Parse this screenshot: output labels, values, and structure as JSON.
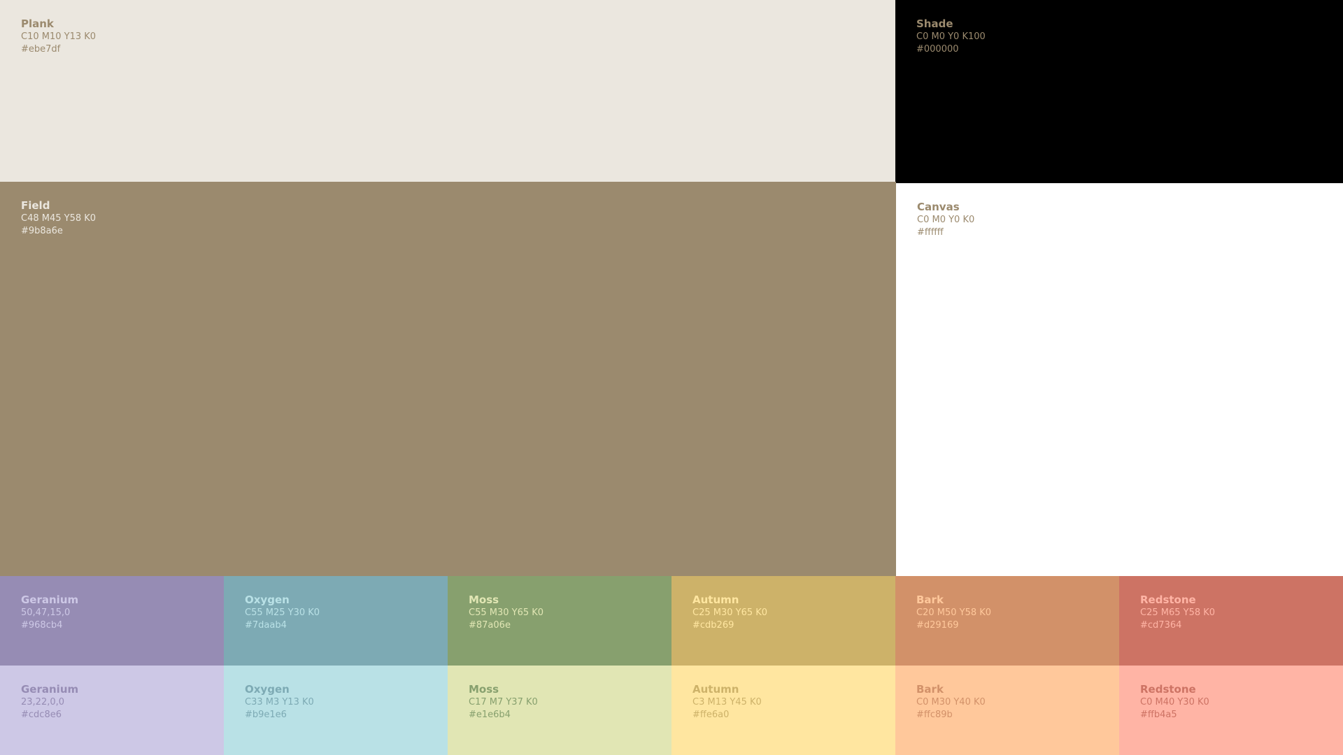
{
  "swatches": {
    "plank": {
      "name": "Plank",
      "cmyk": "C10 M10 Y13 K0",
      "hex": "#ebe7df",
      "bg": "#ebe7df",
      "fg": "#9b8a6e"
    },
    "shade": {
      "name": "Shade",
      "cmyk": "C0 M0 Y0 K100",
      "hex": "#000000",
      "bg": "#000000",
      "fg": "#9b8a6e"
    },
    "field": {
      "name": "Field",
      "cmyk": "C48 M45 Y58 K0",
      "hex": "#9b8a6e",
      "bg": "#9b8a6e",
      "fg": "#ebe7df"
    },
    "canvas": {
      "name": "Canvas",
      "cmyk": "C0 M0 Y0 K0",
      "hex": "#ffffff",
      "bg": "#ffffff",
      "fg": "#9b8a6e"
    },
    "geranium": {
      "name": "Geranium",
      "cmyk": "50,47,15,0",
      "hex": "#968cb4",
      "bg": "#968cb4",
      "fg": "#cdc8e6"
    },
    "oxygen": {
      "name": "Oxygen",
      "cmyk": "C55 M25 Y30 K0",
      "hex": "#7daab4",
      "bg": "#7daab4",
      "fg": "#b9e1e6"
    },
    "moss": {
      "name": "Moss",
      "cmyk": "C55 M30 Y65 K0",
      "hex": "#87a06e",
      "bg": "#87a06e",
      "fg": "#e1e6b4"
    },
    "autumn": {
      "name": "Autumn",
      "cmyk": "C25 M30 Y65 K0",
      "hex": "#cdb269",
      "bg": "#cdb269",
      "fg": "#ffe6a0"
    },
    "bark": {
      "name": "Bark",
      "cmyk": "C20 M50 Y58 K0",
      "hex": "#d29169",
      "bg": "#d29169",
      "fg": "#ffc89b"
    },
    "redstone": {
      "name": "Redstone",
      "cmyk": "C25 M65 Y58 K0",
      "hex": "#cd7364",
      "bg": "#cd7364",
      "fg": "#ffb4a5"
    },
    "geranium2": {
      "name": "Geranium",
      "cmyk": "23,22,0,0",
      "hex": "#cdc8e6",
      "bg": "#cdc8e6",
      "fg": "#968cb4"
    },
    "oxygen2": {
      "name": "Oxygen",
      "cmyk": "C33 M3 Y13 K0",
      "hex": "#b9e1e6",
      "bg": "#b9e1e6",
      "fg": "#7daab4"
    },
    "moss2": {
      "name": "Moss",
      "cmyk": "C17 M7 Y37 K0",
      "hex": "#e1e6b4",
      "bg": "#e1e6b4",
      "fg": "#87a06e"
    },
    "autumn2": {
      "name": "Autumn",
      "cmyk": "C3 M13 Y45 K0",
      "hex": "#ffe6a0",
      "bg": "#ffe6a0",
      "fg": "#cdb269"
    },
    "bark2": {
      "name": "Bark",
      "cmyk": "C0 M30 Y40 K0",
      "hex": "#ffc89b",
      "bg": "#ffc89b",
      "fg": "#d29169"
    },
    "redstone2": {
      "name": "Redstone",
      "cmyk": "C0 M40 Y30 K0",
      "hex": "#ffb4a5",
      "bg": "#ffb4a5",
      "fg": "#cd7364"
    }
  }
}
